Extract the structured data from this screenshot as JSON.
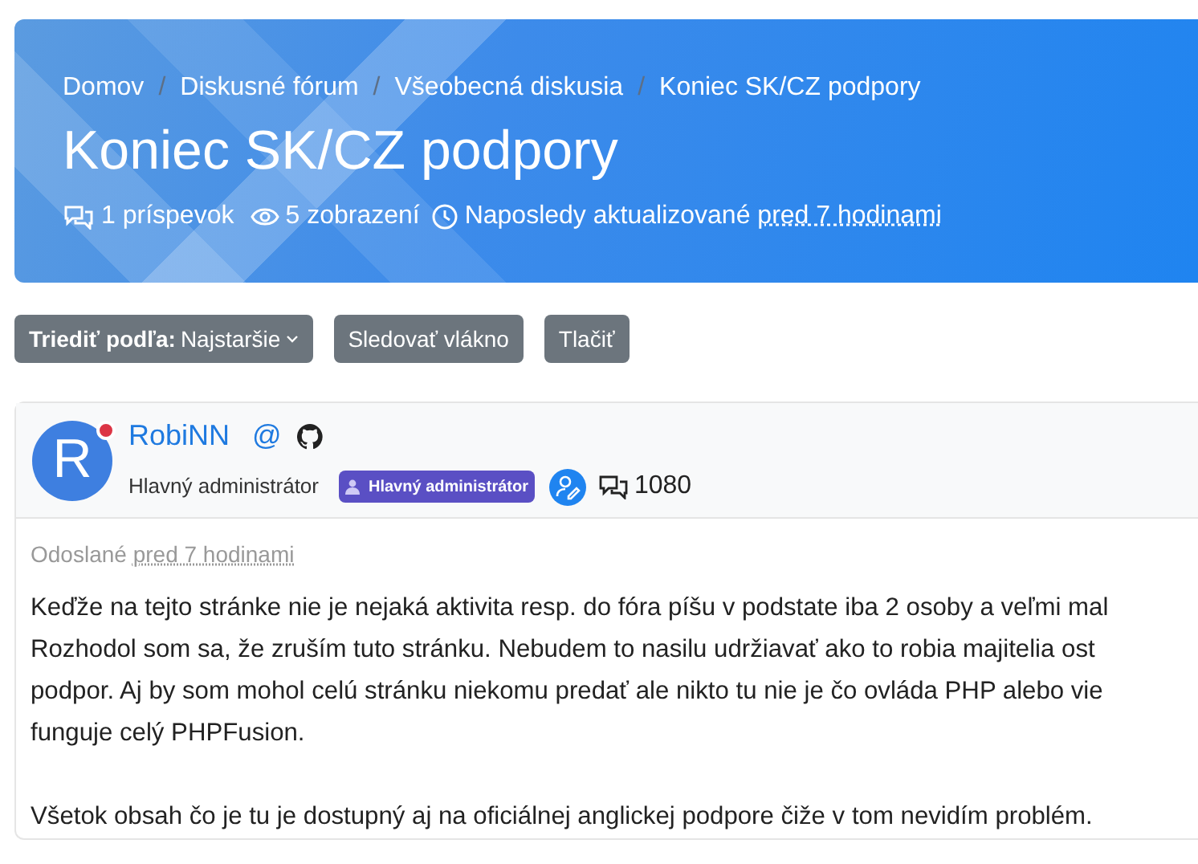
{
  "breadcrumbs": [
    "Domov",
    "Diskusné fórum",
    "Všeobecná diskusia",
    "Koniec SK/CZ podpory"
  ],
  "breadcrumb_separator": "/",
  "title": "Koniec SK/CZ podpory",
  "meta": {
    "posts": "1 príspevok",
    "views": "5 zobrazení",
    "updated_label": "Naposledy aktualizované",
    "updated_time": "pred 7 hodinami"
  },
  "toolbar": {
    "sort_label": "Triediť podľa:",
    "sort_value": "Najstaršie",
    "buttons": [
      "Sledovať vlákno",
      "Tlačiť"
    ]
  },
  "post": {
    "avatar_letter": "R",
    "online": true,
    "author": "RobiNN",
    "at": "@",
    "role": "Hlavný administrátor",
    "badge": "Hlavný administrátor",
    "post_count": "1080",
    "posted_label": "Odoslané",
    "posted_time": "pred 7 hodinami",
    "paragraphs": [
      [
        "Keďže na tejto stránke nie je nejaká aktivita resp. do fóra píšu v podstate iba 2 osoby a veľmi mal",
        "Rozhodol som sa, že zruším tuto stránku. Nebudem to nasilu udržiavať ako to robia majitelia ost",
        "podpor. Aj by som mohol celú stránku niekomu predať ale nikto tu nie je čo ovláda PHP alebo vie",
        "funguje celý PHPFusion."
      ],
      [
        "Všetok obsah čo je tu je dostupný aj na oficiálnej anglickej podpore čiže v tom nevidím problém."
      ]
    ]
  }
}
